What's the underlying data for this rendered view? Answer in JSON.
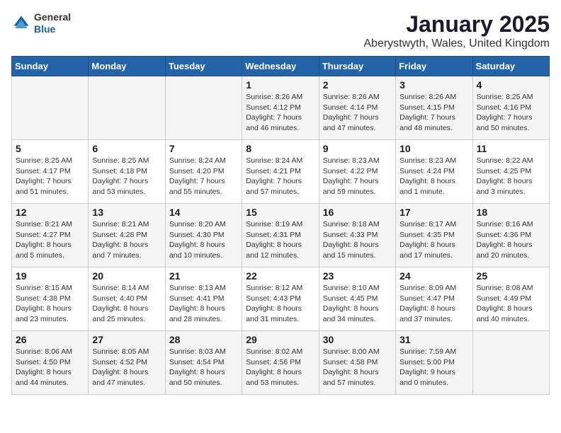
{
  "logo": {
    "general": "General",
    "blue": "Blue"
  },
  "title": "January 2025",
  "subtitle": "Aberystwyth, Wales, United Kingdom",
  "days_of_week": [
    "Sunday",
    "Monday",
    "Tuesday",
    "Wednesday",
    "Thursday",
    "Friday",
    "Saturday"
  ],
  "weeks": [
    [
      {
        "day": "",
        "sunrise": "",
        "sunset": "",
        "daylight": ""
      },
      {
        "day": "",
        "sunrise": "",
        "sunset": "",
        "daylight": ""
      },
      {
        "day": "",
        "sunrise": "",
        "sunset": "",
        "daylight": ""
      },
      {
        "day": "1",
        "sunrise": "Sunrise: 8:26 AM",
        "sunset": "Sunset: 4:12 PM",
        "daylight": "Daylight: 7 hours and 46 minutes."
      },
      {
        "day": "2",
        "sunrise": "Sunrise: 8:26 AM",
        "sunset": "Sunset: 4:14 PM",
        "daylight": "Daylight: 7 hours and 47 minutes."
      },
      {
        "day": "3",
        "sunrise": "Sunrise: 8:26 AM",
        "sunset": "Sunset: 4:15 PM",
        "daylight": "Daylight: 7 hours and 48 minutes."
      },
      {
        "day": "4",
        "sunrise": "Sunrise: 8:25 AM",
        "sunset": "Sunset: 4:16 PM",
        "daylight": "Daylight: 7 hours and 50 minutes."
      }
    ],
    [
      {
        "day": "5",
        "sunrise": "Sunrise: 8:25 AM",
        "sunset": "Sunset: 4:17 PM",
        "daylight": "Daylight: 7 hours and 51 minutes."
      },
      {
        "day": "6",
        "sunrise": "Sunrise: 8:25 AM",
        "sunset": "Sunset: 4:18 PM",
        "daylight": "Daylight: 7 hours and 53 minutes."
      },
      {
        "day": "7",
        "sunrise": "Sunrise: 8:24 AM",
        "sunset": "Sunset: 4:20 PM",
        "daylight": "Daylight: 7 hours and 55 minutes."
      },
      {
        "day": "8",
        "sunrise": "Sunrise: 8:24 AM",
        "sunset": "Sunset: 4:21 PM",
        "daylight": "Daylight: 7 hours and 57 minutes."
      },
      {
        "day": "9",
        "sunrise": "Sunrise: 8:23 AM",
        "sunset": "Sunset: 4:22 PM",
        "daylight": "Daylight: 7 hours and 59 minutes."
      },
      {
        "day": "10",
        "sunrise": "Sunrise: 8:23 AM",
        "sunset": "Sunset: 4:24 PM",
        "daylight": "Daylight: 8 hours and 1 minute."
      },
      {
        "day": "11",
        "sunrise": "Sunrise: 8:22 AM",
        "sunset": "Sunset: 4:25 PM",
        "daylight": "Daylight: 8 hours and 3 minutes."
      }
    ],
    [
      {
        "day": "12",
        "sunrise": "Sunrise: 8:21 AM",
        "sunset": "Sunset: 4:27 PM",
        "daylight": "Daylight: 8 hours and 5 minutes."
      },
      {
        "day": "13",
        "sunrise": "Sunrise: 8:21 AM",
        "sunset": "Sunset: 4:28 PM",
        "daylight": "Daylight: 8 hours and 7 minutes."
      },
      {
        "day": "14",
        "sunrise": "Sunrise: 8:20 AM",
        "sunset": "Sunset: 4:30 PM",
        "daylight": "Daylight: 8 hours and 10 minutes."
      },
      {
        "day": "15",
        "sunrise": "Sunrise: 8:19 AM",
        "sunset": "Sunset: 4:31 PM",
        "daylight": "Daylight: 8 hours and 12 minutes."
      },
      {
        "day": "16",
        "sunrise": "Sunrise: 8:18 AM",
        "sunset": "Sunset: 4:33 PM",
        "daylight": "Daylight: 8 hours and 15 minutes."
      },
      {
        "day": "17",
        "sunrise": "Sunrise: 8:17 AM",
        "sunset": "Sunset: 4:35 PM",
        "daylight": "Daylight: 8 hours and 17 minutes."
      },
      {
        "day": "18",
        "sunrise": "Sunrise: 8:16 AM",
        "sunset": "Sunset: 4:36 PM",
        "daylight": "Daylight: 8 hours and 20 minutes."
      }
    ],
    [
      {
        "day": "19",
        "sunrise": "Sunrise: 8:15 AM",
        "sunset": "Sunset: 4:38 PM",
        "daylight": "Daylight: 8 hours and 23 minutes."
      },
      {
        "day": "20",
        "sunrise": "Sunrise: 8:14 AM",
        "sunset": "Sunset: 4:40 PM",
        "daylight": "Daylight: 8 hours and 25 minutes."
      },
      {
        "day": "21",
        "sunrise": "Sunrise: 8:13 AM",
        "sunset": "Sunset: 4:41 PM",
        "daylight": "Daylight: 8 hours and 28 minutes."
      },
      {
        "day": "22",
        "sunrise": "Sunrise: 8:12 AM",
        "sunset": "Sunset: 4:43 PM",
        "daylight": "Daylight: 8 hours and 31 minutes."
      },
      {
        "day": "23",
        "sunrise": "Sunrise: 8:10 AM",
        "sunset": "Sunset: 4:45 PM",
        "daylight": "Daylight: 8 hours and 34 minutes."
      },
      {
        "day": "24",
        "sunrise": "Sunrise: 8:09 AM",
        "sunset": "Sunset: 4:47 PM",
        "daylight": "Daylight: 8 hours and 37 minutes."
      },
      {
        "day": "25",
        "sunrise": "Sunrise: 8:08 AM",
        "sunset": "Sunset: 4:49 PM",
        "daylight": "Daylight: 8 hours and 40 minutes."
      }
    ],
    [
      {
        "day": "26",
        "sunrise": "Sunrise: 8:06 AM",
        "sunset": "Sunset: 4:50 PM",
        "daylight": "Daylight: 8 hours and 44 minutes."
      },
      {
        "day": "27",
        "sunrise": "Sunrise: 8:05 AM",
        "sunset": "Sunset: 4:52 PM",
        "daylight": "Daylight: 8 hours and 47 minutes."
      },
      {
        "day": "28",
        "sunrise": "Sunrise: 8:03 AM",
        "sunset": "Sunset: 4:54 PM",
        "daylight": "Daylight: 8 hours and 50 minutes."
      },
      {
        "day": "29",
        "sunrise": "Sunrise: 8:02 AM",
        "sunset": "Sunset: 4:56 PM",
        "daylight": "Daylight: 8 hours and 53 minutes."
      },
      {
        "day": "30",
        "sunrise": "Sunrise: 8:00 AM",
        "sunset": "Sunset: 4:58 PM",
        "daylight": "Daylight: 8 hours and 57 minutes."
      },
      {
        "day": "31",
        "sunrise": "Sunrise: 7:59 AM",
        "sunset": "Sunset: 5:00 PM",
        "daylight": "Daylight: 9 hours and 0 minutes."
      },
      {
        "day": "",
        "sunrise": "",
        "sunset": "",
        "daylight": ""
      }
    ]
  ]
}
